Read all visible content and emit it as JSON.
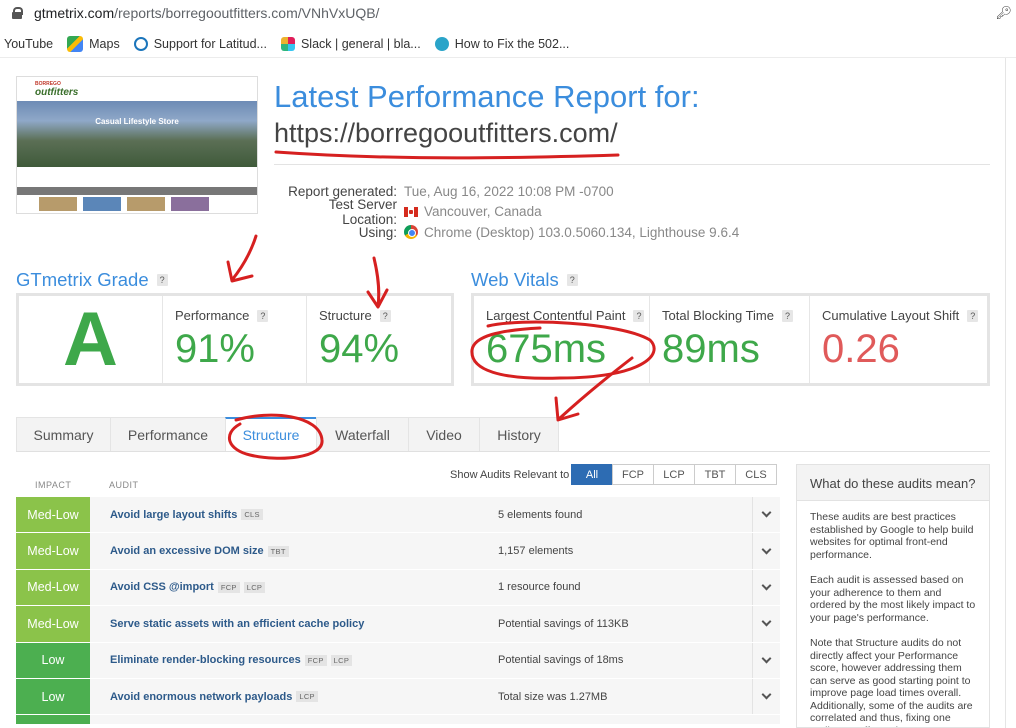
{
  "browser": {
    "url_host": "gtmetrix.com",
    "url_path": "/reports/borregooutfitters.com/VNhVxUQB/",
    "bookmarks": [
      {
        "label": "YouTube",
        "icon": "youtube-icon",
        "color": "#ffffff"
      },
      {
        "label": "Maps",
        "icon": "maps-icon",
        "color": "#34a853"
      },
      {
        "label": "Support for Latitud...",
        "icon": "dell-icon",
        "color": "#1b75bb"
      },
      {
        "label": "Slack | general | bla...",
        "icon": "slack-icon",
        "color": "#e01e5a"
      },
      {
        "label": "How to Fix the 502...",
        "icon": "web-icon",
        "color": "#2aa4c9"
      }
    ]
  },
  "report": {
    "title": "Latest Performance Report for:",
    "url": "https://borregooutfitters.com/",
    "generated_label": "Report generated:",
    "generated_value": "Tue, Aug 16, 2022 10:08 PM -0700",
    "location_label": "Test Server Location:",
    "location_value": "Vancouver, Canada",
    "using_label": "Using:",
    "using_value": "Chrome (Desktop) 103.0.5060.134, Lighthouse 9.6.4"
  },
  "thumbnail": {
    "logo": "outfitters",
    "logo_top": "BORREGO",
    "hero": "Casual Lifestyle Store"
  },
  "grade": {
    "heading": "GTmetrix Grade",
    "letter": "A",
    "performance_label": "Performance",
    "performance_value": "91%",
    "structure_label": "Structure",
    "structure_value": "94%"
  },
  "vitals": {
    "heading": "Web Vitals",
    "lcp_label": "Largest Contentful Paint",
    "lcp_value": "675ms",
    "tbt_label": "Total Blocking Time",
    "tbt_value": "89ms",
    "cls_label": "Cumulative Layout Shift",
    "cls_value": "0.26"
  },
  "tabs": [
    "Summary",
    "Performance",
    "Structure",
    "Waterfall",
    "Video",
    "History"
  ],
  "active_tab": "Structure",
  "audits_header": {
    "impact": "IMPACT",
    "audit": "AUDIT",
    "filter_label": "Show Audits Relevant to",
    "filters": [
      "All",
      "FCP",
      "LCP",
      "TBT",
      "CLS"
    ],
    "active_filter": "All"
  },
  "audits": [
    {
      "impact": "Med-Low",
      "name": "Avoid large layout shifts",
      "tags": [
        "CLS"
      ],
      "finding": "5 elements found"
    },
    {
      "impact": "Med-Low",
      "name": "Avoid an excessive DOM size",
      "tags": [
        "TBT"
      ],
      "finding": "1,157 elements"
    },
    {
      "impact": "Med-Low",
      "name": "Avoid CSS @import",
      "tags": [
        "FCP",
        "LCP"
      ],
      "finding": "1 resource found"
    },
    {
      "impact": "Med-Low",
      "name": "Serve static assets with an efficient cache policy",
      "tags": [],
      "finding": "Potential savings of 113KB"
    },
    {
      "impact": "Low",
      "name": "Eliminate render-blocking resources",
      "tags": [
        "FCP",
        "LCP"
      ],
      "finding": "Potential savings of 18ms"
    },
    {
      "impact": "Low",
      "name": "Avoid enormous network payloads",
      "tags": [
        "LCP"
      ],
      "finding": "Total size was 1.27MB"
    }
  ],
  "side_panel": {
    "title": "What do these audits mean?",
    "p1": "These audits are best practices established by Google to help build websites for optimal front-end performance.",
    "p2": "Each audit is assessed based on your adherence to them and ordered by the most likely impact to your page's performance.",
    "p3": "Note that Structure audits do not directly affect your Performance score, however addressing them can serve as good starting point to improve page load times overall. Additionally, some of the audits are correlated and thus, fixing one audit may affect others."
  },
  "colors": {
    "accent": "#3b8ddd",
    "good": "#3ea84a",
    "bad": "#e05a5a",
    "impact_medlow": "#8bc34a",
    "impact_low": "#4caf50",
    "annotation": "#d62020"
  }
}
